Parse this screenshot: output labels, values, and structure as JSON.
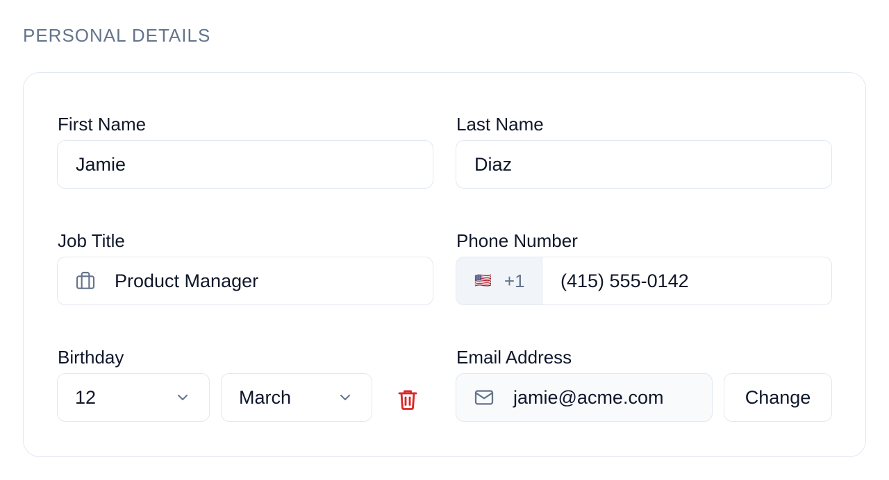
{
  "section": {
    "title": "PERSONAL DETAILS"
  },
  "fields": {
    "first_name": {
      "label": "First Name",
      "value": "Jamie"
    },
    "last_name": {
      "label": "Last Name",
      "value": "Diaz"
    },
    "job_title": {
      "label": "Job Title",
      "value": "Product Manager",
      "icon": "briefcase-icon"
    },
    "phone": {
      "label": "Phone Number",
      "flag": "🇺🇸",
      "country_code": "+1",
      "value": "(415) 555-0142"
    },
    "birthday": {
      "label": "Birthday",
      "day": "12",
      "month": "March",
      "clear_icon": "trash-icon"
    },
    "email": {
      "label": "Email Address",
      "value": "jamie@acme.com",
      "icon": "mail-icon",
      "action_label": "Change"
    }
  },
  "colors": {
    "border": "#e2e8f0",
    "muted": "#64748b",
    "danger": "#dc2626",
    "prefix_bg": "#f1f5f9",
    "readonly_bg": "#f8fafc"
  }
}
